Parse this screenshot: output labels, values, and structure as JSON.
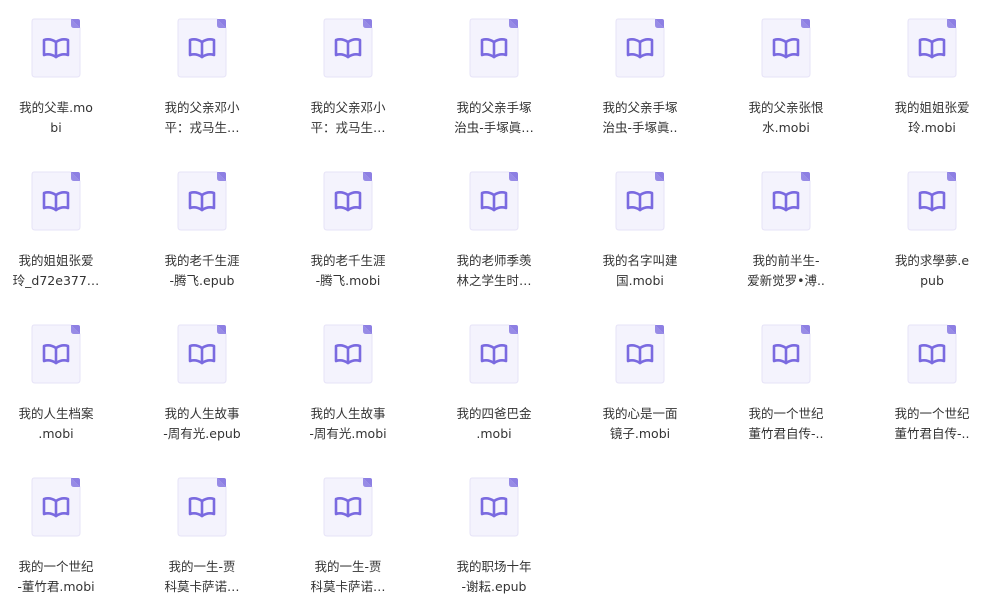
{
  "files": [
    {
      "line1": "我的父辈.mo",
      "line2": "bi",
      "icon": "book-file-icon"
    },
    {
      "line1": "我的父亲邓小",
      "line2": "平：戎马生…",
      "icon": "book-file-icon"
    },
    {
      "line1": "我的父亲邓小",
      "line2": "平：戎马生…",
      "icon": "book-file-icon"
    },
    {
      "line1": "我的父亲手塚",
      "line2": "治虫-手塚眞…",
      "icon": "book-file-icon"
    },
    {
      "line1": "我的父亲手塚",
      "line2": "治虫-手塚眞..",
      "icon": "book-file-icon"
    },
    {
      "line1": "我的父亲张恨",
      "line2": "水.mobi",
      "icon": "book-file-icon"
    },
    {
      "line1": "我的姐姐张爱",
      "line2": "玲.mobi",
      "icon": "book-file-icon"
    },
    {
      "line1": "我的姐姐张爱",
      "line2": "玲_d72e377…",
      "icon": "book-file-icon"
    },
    {
      "line1": "我的老千生涯",
      "line2": "-腾飞.epub",
      "icon": "book-file-icon"
    },
    {
      "line1": "我的老千生涯",
      "line2": "-腾飞.mobi",
      "icon": "book-file-icon"
    },
    {
      "line1": "我的老师季羡",
      "line2": "林之学生时…",
      "icon": "book-file-icon"
    },
    {
      "line1": "我的名字叫建",
      "line2": "国.mobi",
      "icon": "book-file-icon"
    },
    {
      "line1": "我的前半生-",
      "line2": "爱新觉罗•溥..",
      "icon": "book-file-icon"
    },
    {
      "line1": "我的求學夢.e",
      "line2": "pub",
      "icon": "book-file-icon"
    },
    {
      "line1": "我的人生档案",
      "line2": ".mobi",
      "icon": "book-file-icon"
    },
    {
      "line1": "我的人生故事",
      "line2": "-周有光.epub",
      "icon": "book-file-icon"
    },
    {
      "line1": "我的人生故事",
      "line2": "-周有光.mobi",
      "icon": "book-file-icon"
    },
    {
      "line1": "我的四爸巴金",
      "line2": ".mobi",
      "icon": "book-file-icon"
    },
    {
      "line1": "我的心是一面",
      "line2": "镜子.mobi",
      "icon": "book-file-icon"
    },
    {
      "line1": "我的一个世纪",
      "line2": "董竹君自传-..",
      "icon": "book-file-icon"
    },
    {
      "line1": "我的一个世纪",
      "line2": "董竹君自传-..",
      "icon": "book-file-icon"
    },
    {
      "line1": "我的一个世纪",
      "line2": "-董竹君.mobi",
      "icon": "book-file-icon"
    },
    {
      "line1": "我的一生-贾",
      "line2": "科莫卡萨诺…",
      "icon": "book-file-icon"
    },
    {
      "line1": "我的一生-贾",
      "line2": "科莫卡萨诺…",
      "icon": "book-file-icon"
    },
    {
      "line1": "我的职场十年",
      "line2": "-谢耘.epub",
      "icon": "book-file-icon"
    }
  ],
  "colors": {
    "doc_fill": "#f4f3fd",
    "doc_border": "#e6e3f7",
    "doc_fold": "#8d7fe3",
    "book_stroke": "#7a6ae0",
    "text": "#333333"
  }
}
